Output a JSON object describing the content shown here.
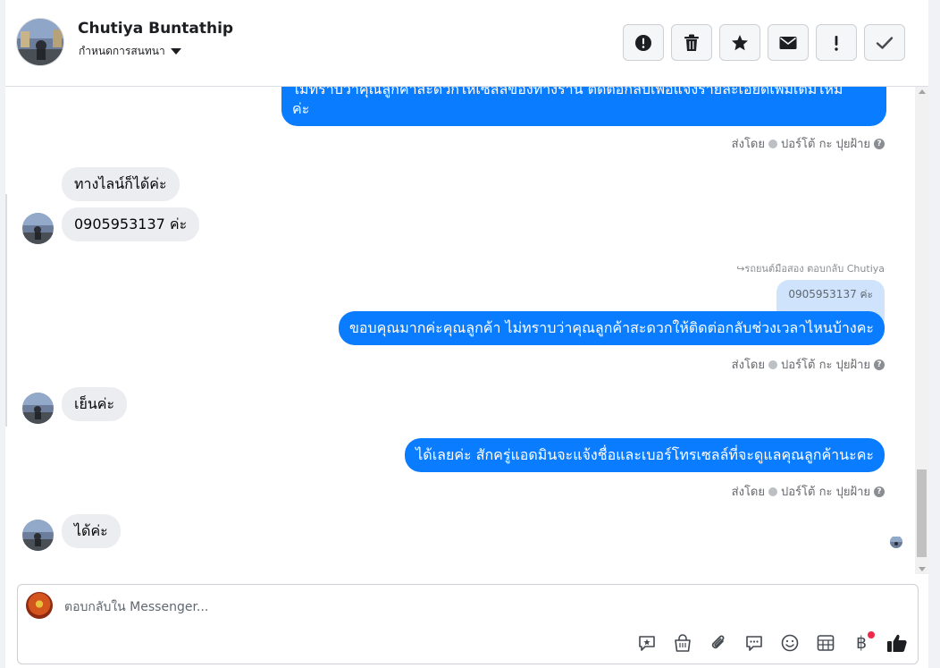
{
  "header": {
    "contact_name": "Chutiya Buntathip",
    "assign_label": "กำหนดการสนทนา",
    "actions": [
      {
        "icon": "alert-circle-icon"
      },
      {
        "icon": "trash-icon"
      },
      {
        "icon": "star-icon"
      },
      {
        "icon": "envelope-icon"
      },
      {
        "icon": "exclamation-icon"
      },
      {
        "icon": "checkmark-icon"
      }
    ]
  },
  "messages": [
    {
      "from": "page",
      "text_line1": "ไม่ทราบว่าคุณลูกค้าสะดวกให้เซลล์ของทางร้าน ติดต่อกลับเพื่อแจ้งรายละเอียดเพิ่มเติมไหม",
      "text_line2": "ค่ะ",
      "sent_by": "ส่งโดย",
      "sender": "ปอร์โต้ กะ ปุยฝ้าย"
    },
    {
      "from": "customer",
      "text": "ทางไลน์ก็ได้ค่ะ"
    },
    {
      "from": "customer",
      "text": "0905953137 ค่ะ"
    },
    {
      "from": "page",
      "reply_meta": "รถยนต์มือสอง ตอบกลับ Chutiya",
      "quoted": "0905953137 ค่ะ",
      "text": "ขอบคุณมากค่ะคุณลูกค้า ไม่ทราบว่าคุณลูกค้าสะดวกให้ติดต่อกลับช่วงเวลาไหนบ้างคะ",
      "sent_by": "ส่งโดย",
      "sender": "ปอร์โต้ กะ ปุยฝ้าย"
    },
    {
      "from": "customer",
      "text": "เย็นค่ะ"
    },
    {
      "from": "page",
      "text": "ได้เลยค่ะ สักครู่แอดมินจะแจ้งชื่อและเบอร์โทรเซลล์ที่จะดูแลคุณลูกค้านะคะ",
      "sent_by": "ส่งโดย",
      "sender": "ปอร์โต้ กะ ปุยฝ้าย"
    },
    {
      "from": "customer",
      "text": "ได้ค่ะ"
    }
  ],
  "composer": {
    "placeholder": "ตอบกลับใน Messenger...",
    "tools": [
      "saved-reply-icon",
      "shopping-bag-icon",
      "paperclip-icon",
      "chat-bubble-icon",
      "emoji-icon",
      "table-icon",
      "baht-icon",
      "thumbs-up-icon"
    ],
    "baht_symbol": "฿"
  },
  "colors": {
    "outgoing_bubble": "#0a7cff",
    "incoming_bubble": "#ebedf0",
    "notification_dot": "#f02849"
  }
}
